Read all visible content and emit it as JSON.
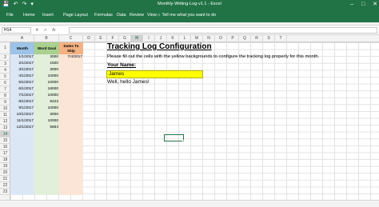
{
  "app": {
    "title": "Monthly-Writing-Log-v1.1 - Excel",
    "accent": "#217346",
    "quick_access": [
      "save-icon",
      "undo-icon",
      "redo-icon",
      "customize-icon"
    ],
    "window_controls": [
      "minimize-icon",
      "restore-icon",
      "close-icon"
    ]
  },
  "ribbon": {
    "tabs": [
      "File",
      "Home",
      "Insert",
      "Page Layout",
      "Formulas",
      "Data",
      "Review",
      "View"
    ],
    "tell_me": "Tell me what you want to do"
  },
  "formula_bar": {
    "name_box": "H14",
    "fx": "fx",
    "content": ""
  },
  "columns": [
    "A",
    "B",
    "C",
    "D",
    "E",
    "F",
    "G",
    "H",
    "I",
    "J",
    "K",
    "L",
    "M",
    "N",
    "O",
    "P",
    "Q",
    "R",
    "S",
    "T"
  ],
  "selected_column": "H",
  "rows": [
    "1",
    "2",
    "3",
    "4",
    "5",
    "6",
    "7",
    "8",
    "9",
    "10",
    "11",
    "12",
    "13",
    "14",
    "15",
    "16",
    "17",
    "18",
    "19",
    "20",
    "21",
    "22",
    "23"
  ],
  "selected_row": "14",
  "log_table": {
    "headers": {
      "month": "Month",
      "goal": "Word Goal",
      "skip": "Dates To Skip"
    },
    "months": [
      "1/1/2017",
      "2/1/2017",
      "3/1/2017",
      "4/1/2017",
      "5/1/2017",
      "6/1/2017",
      "7/1/2017",
      "8/1/2017",
      "9/1/2017",
      "10/1/2017",
      "11/1/2017",
      "12/1/2017"
    ],
    "goals": [
      "3000",
      "1500",
      "3000",
      "10000",
      "10000",
      "18000",
      "10000",
      "8423",
      "10000",
      "3000",
      "10000",
      "5854"
    ],
    "skip_dates": [
      "7/4/2017"
    ],
    "colors": {
      "month_col": "#dbe7f5",
      "month_header": "#9dc3e6",
      "goal_col": "#e2efda",
      "goal_header": "#a9d08e",
      "skip_col": "#fbe5d6",
      "skip_header": "#f4b183"
    }
  },
  "config": {
    "title": "Tracking Log Configuration",
    "note": "Please fill out the cells with the yellow backgrounds to configure the tracking log properly for this month.",
    "name_label": "Your Name:",
    "name_value": "James",
    "greeting": "Well, hello James!",
    "input_color": "#ffff00"
  }
}
